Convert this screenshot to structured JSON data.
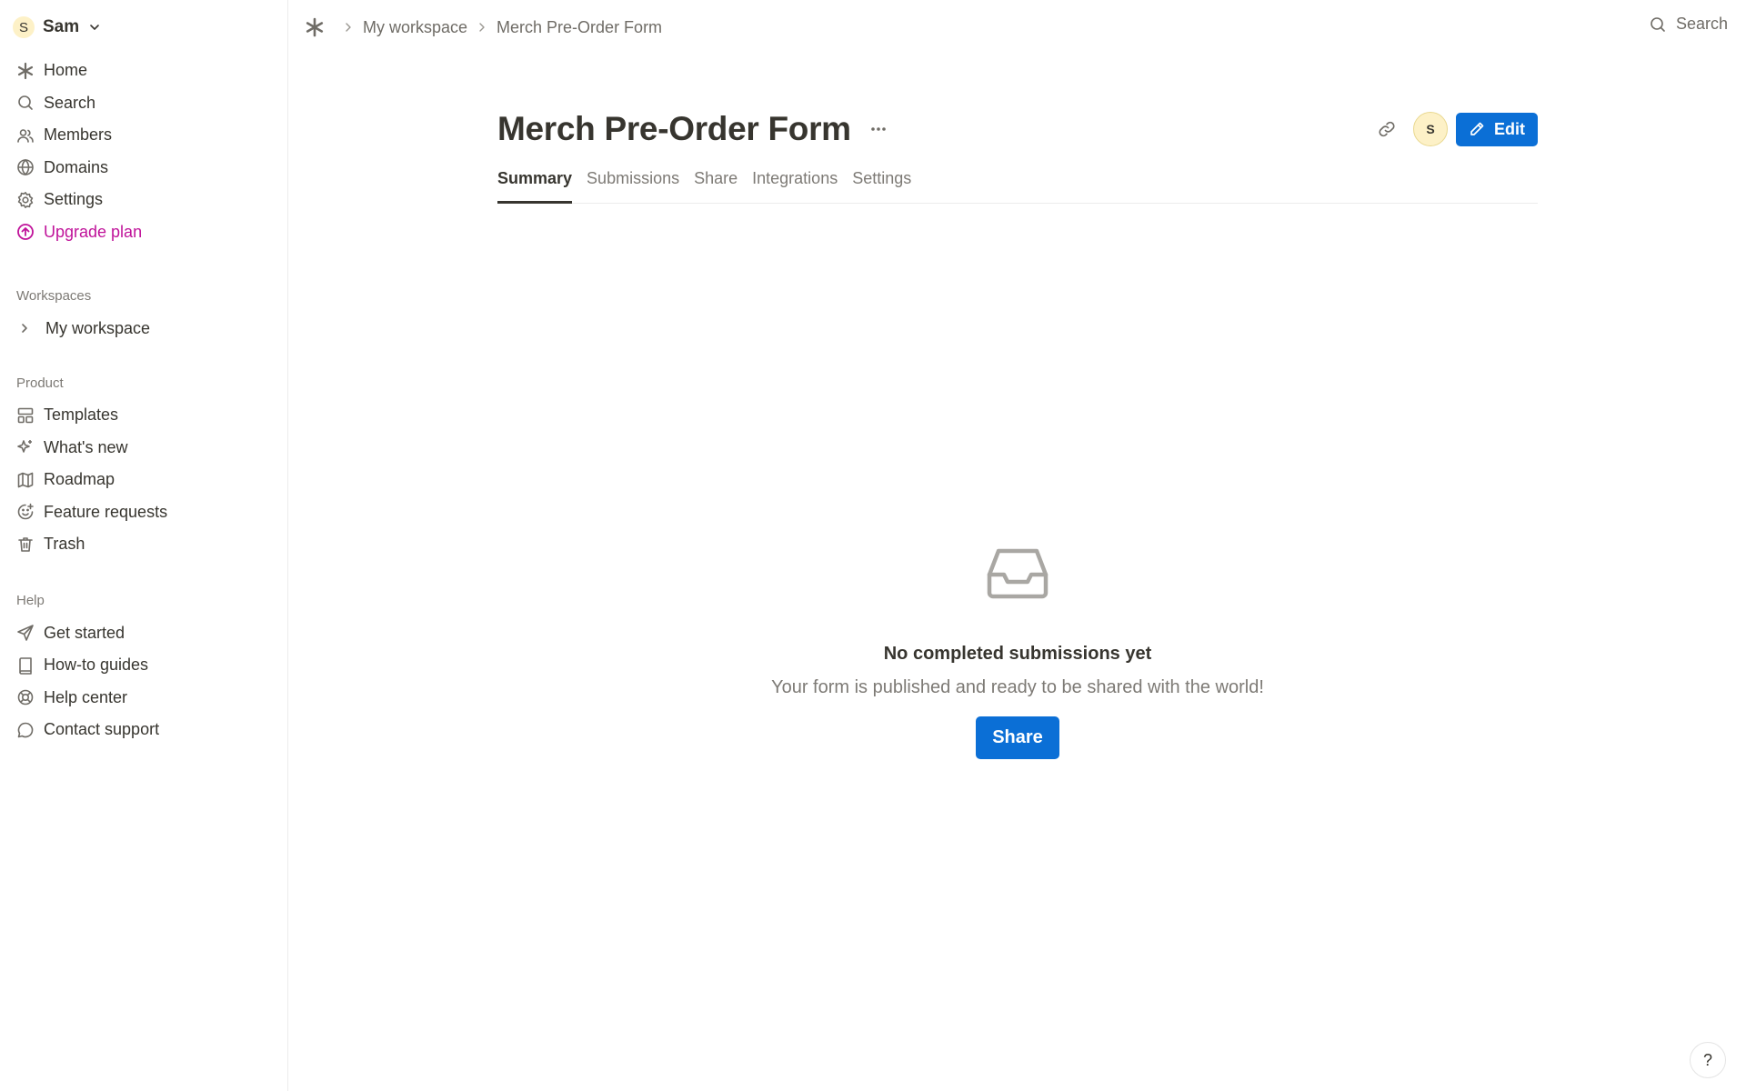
{
  "account": {
    "initial": "S",
    "name": "Sam",
    "icon": "chevron-down-icon"
  },
  "sidebar": {
    "nav": [
      {
        "label": "Home",
        "icon": "asterisk-icon"
      },
      {
        "label": "Search",
        "icon": "search-icon"
      },
      {
        "label": "Members",
        "icon": "users-icon"
      },
      {
        "label": "Domains",
        "icon": "globe-icon"
      },
      {
        "label": "Settings",
        "icon": "gear-icon"
      },
      {
        "label": "Upgrade plan",
        "icon": "arrow-up-circle-icon",
        "color": "#c0139a"
      }
    ],
    "workspaces_label": "Workspaces",
    "workspaces": [
      {
        "label": "My workspace",
        "icon": "chevron-right-icon"
      }
    ],
    "product_label": "Product",
    "product": [
      {
        "label": "Templates",
        "icon": "layout-icon"
      },
      {
        "label": "What's new",
        "icon": "sparkle-icon"
      },
      {
        "label": "Roadmap",
        "icon": "map-icon"
      },
      {
        "label": "Feature requests",
        "icon": "smile-plus-icon"
      },
      {
        "label": "Trash",
        "icon": "trash-icon"
      }
    ],
    "help_label": "Help",
    "help": [
      {
        "label": "Get started",
        "icon": "send-icon"
      },
      {
        "label": "How-to guides",
        "icon": "book-icon"
      },
      {
        "label": "Help center",
        "icon": "lifebuoy-icon"
      },
      {
        "label": "Contact support",
        "icon": "chat-bubble-icon"
      }
    ]
  },
  "breadcrumb": {
    "items": [
      "My workspace",
      "Merch Pre-Order Form"
    ]
  },
  "topbar": {
    "search_label": "Search"
  },
  "page": {
    "title": "Merch Pre-Order Form",
    "avatar_initial": "S",
    "edit_label": "Edit",
    "tabs": [
      "Summary",
      "Submissions",
      "Share",
      "Integrations",
      "Settings"
    ],
    "active_tab": "Summary"
  },
  "empty_state": {
    "title": "No completed submissions yet",
    "subtitle": "Your form is published and ready to be shared with the world!",
    "button_label": "Share"
  },
  "help_button": {
    "label": "?"
  },
  "colors": {
    "accent": "#0b6fd6",
    "upgrade": "#c0139a",
    "avatar_bg": "#fdf1c7"
  }
}
